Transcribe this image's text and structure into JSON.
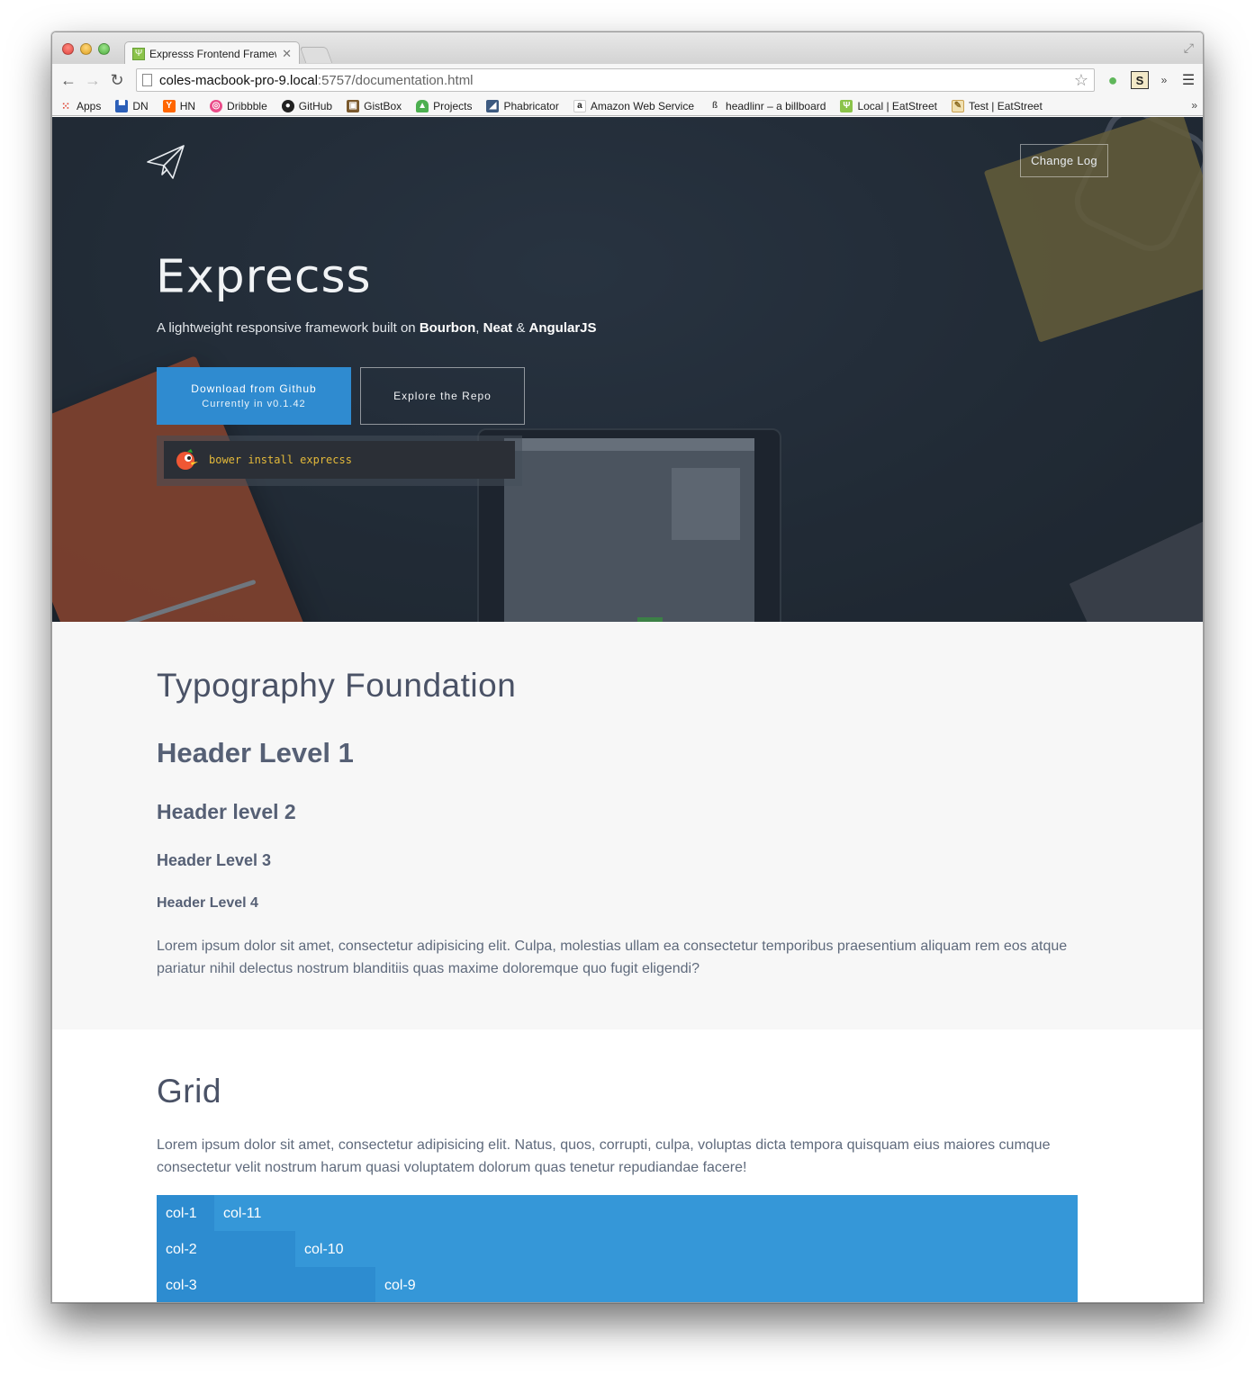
{
  "browser": {
    "tab_title": "Expresss Frontend Framew",
    "url_host": "coles-macbook-pro-9.local",
    "url_path": ":5757/documentation.html"
  },
  "bookmarks": [
    {
      "label": "Apps",
      "icon": "apps-grid-icon",
      "color": "#e04a3a"
    },
    {
      "label": "DN",
      "icon": "dn-icon",
      "color": "#2c5fb8"
    },
    {
      "label": "HN",
      "icon": "hn-icon",
      "color": "#ff6600"
    },
    {
      "label": "Dribbble",
      "icon": "dribbble-icon",
      "color": "#ea4c89"
    },
    {
      "label": "GitHub",
      "icon": "github-icon",
      "color": "#222222"
    },
    {
      "label": "GistBox",
      "icon": "gistbox-icon",
      "color": "#7b5a2e"
    },
    {
      "label": "Projects",
      "icon": "projects-icon",
      "color": "#4caf50"
    },
    {
      "label": "Phabricator",
      "icon": "phabricator-icon",
      "color": "#3d5a80"
    },
    {
      "label": "Amazon Web Service",
      "icon": "amazon-icon",
      "color": "#222222"
    },
    {
      "label": "headlinr – a billboard",
      "icon": "headlinr-icon",
      "color": "#555555"
    },
    {
      "label": "Local | EatStreet",
      "icon": "eatstreet-icon",
      "color": "#8bc34a"
    },
    {
      "label": "Test | EatStreet",
      "icon": "test-eatstreet-icon",
      "color": "#c8a050"
    }
  ],
  "hero": {
    "changelog": "Change Log",
    "title": "Exprecss",
    "subtitle_prefix": "A lightweight responsive framework built on ",
    "bourbon": "Bourbon",
    "comma": ", ",
    "neat": "Neat",
    "amp": " & ",
    "angular": "AngularJS",
    "download_line1": "Download from Github",
    "download_line2": "Currently in v0.1.42",
    "explore": "Explore the Repo",
    "bower_cmd": "bower install exprecss"
  },
  "typography": {
    "title": "Typography Foundation",
    "h1": "Header Level 1",
    "h2": "Header level 2",
    "h3": "Header Level 3",
    "h4": "Header Level 4",
    "paragraph": "Lorem ipsum dolor sit amet, consectetur adipisicing elit. Culpa, molestias ullam ea consectetur temporibus praesentium aliquam rem eos atque pariatur nihil delectus nostrum blanditiis quas maxime doloremque quo fugit eligendi?"
  },
  "grid": {
    "title": "Grid",
    "paragraph": "Lorem ipsum dolor sit amet, consectetur adipisicing elit. Natus, quos, corrupti, culpa, voluptas dicta tempora quisquam eius maiores cumque consectetur velit nostrum harum quasi voluptatem dolorum quas tenetur repudiandae facere!",
    "rows": [
      {
        "left": "col-1",
        "right": "col-11"
      },
      {
        "left": "col-2",
        "right": "col-10"
      },
      {
        "left": "col-3",
        "right": "col-9"
      }
    ]
  },
  "colors": {
    "accent": "#2f8bd0",
    "grid_dark": "#2d8cd0",
    "grid_light": "#3597d8",
    "bower_text": "#e3b93a"
  }
}
